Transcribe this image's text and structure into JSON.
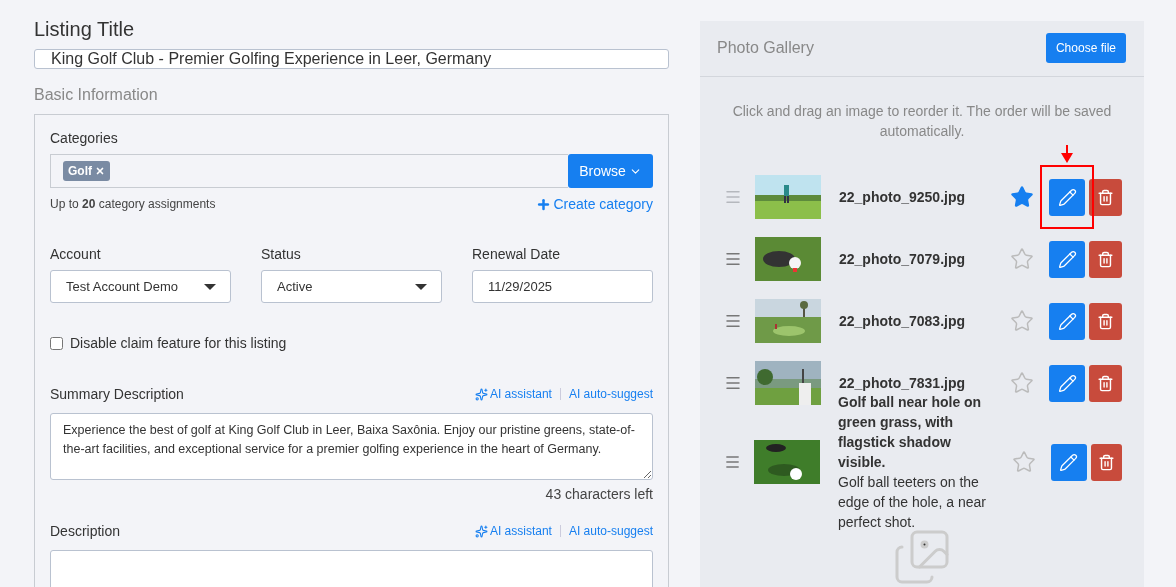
{
  "listing_title": {
    "label": "Listing Title",
    "value": "King Golf Club - Premier Golfing Experience in Leer, Germany"
  },
  "section_title": "Basic Information",
  "categories": {
    "label": "Categories",
    "tags": [
      "Golf"
    ],
    "browse_button": "Browse",
    "hint": "Up to **20** category assignments",
    "create_link": "Create category"
  },
  "fields": [
    {
      "label": "Account",
      "kind": "select",
      "value": "Test Account Demo"
    },
    {
      "label": "Status",
      "kind": "select",
      "value": "Active"
    },
    {
      "label": "Renewal Date",
      "kind": "date",
      "value": "11/29/2025"
    }
  ],
  "claim_checkbox": {
    "label": "Disable claim feature for this listing",
    "checked": false
  },
  "summary": {
    "label": "Summary Description",
    "ai_links": [
      "AI assistant",
      "AI auto-suggest"
    ],
    "value": "Experience the best of golf at King Golf Club in Leer, Baixa Saxônia. Enjoy our pristine greens, state-of-the-art facilities, and exceptional service for a premier golfing experience in the heart of Germany.",
    "counter": "43 characters left"
  },
  "description": {
    "label": "Description",
    "ai_links": [
      "AI assistant",
      "AI auto-suggest"
    ]
  },
  "gallery": {
    "title": "Photo Gallery",
    "choose_button": "Choose file",
    "hint": "Click and drag an image to reorder it. The order will be saved automatically.",
    "photos": [
      {
        "title": "22_photo_9250.jpg",
        "featured": true,
        "highlighted": true
      },
      {
        "title": "22_photo_7079.jpg",
        "featured": false,
        "highlighted": false
      },
      {
        "title": "22_photo_7083.jpg",
        "featured": false,
        "highlighted": false
      },
      {
        "title": "22_photo_7831.jpg",
        "featured": false,
        "highlighted": false
      },
      {
        "title": "Golf ball near hole on green grass, with flagstick shadow visible.",
        "caption": "Golf ball teeters on the edge of the hole, a near perfect shot.",
        "featured": false,
        "highlighted": false
      }
    ]
  }
}
